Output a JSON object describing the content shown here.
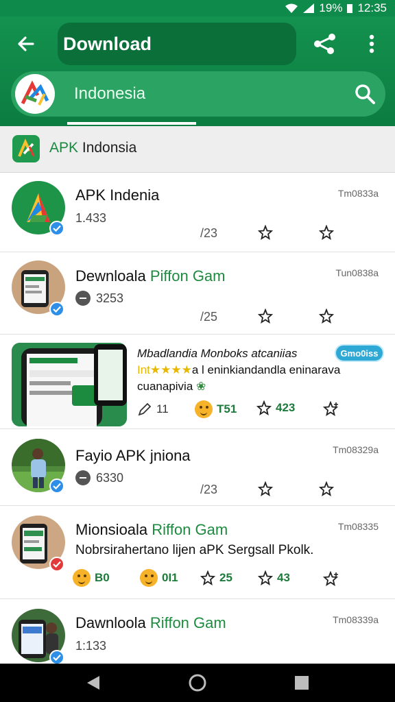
{
  "status": {
    "battery": "19%",
    "time": "12:35"
  },
  "header": {
    "title": "Download",
    "search_text": "Indonesia"
  },
  "section": {
    "title_green": "APK",
    "title_rest": " Indonsia"
  },
  "items": [
    {
      "name": "APK Indenia",
      "name_green": "",
      "meta": "1.433",
      "time": "Tm0833a",
      "count": "/23"
    },
    {
      "name": "Dewnloala ",
      "name_green": "Piffon Gam",
      "meta": "3253",
      "time": "Tun0838a",
      "count": "/25"
    },
    {
      "name": "Fayio APK jniona",
      "name_green": "",
      "meta": "6330",
      "time": "Tm08329a",
      "count": "/23"
    },
    {
      "name": "Mionsioala ",
      "name_green": "Riffon Gam",
      "desc": "Nobrsirahertano lijen aPK Sergsall Pkolk.",
      "time": "Tm08335",
      "reactions": [
        "B0",
        "0I1",
        "25",
        "43"
      ]
    },
    {
      "name": "Dawnloola ",
      "name_green": "Riffon Gam",
      "meta": "1:133",
      "time": "Tm08339a"
    }
  ],
  "promo": {
    "title": "Mbadlandia Monboks atcaniias",
    "stars": "Int★★★★",
    "line2_rest": "a l eninkiandandla eninarava",
    "line3": "cuanapivia",
    "pill": "Gmo0iss",
    "reactions": [
      "11",
      "T51",
      "423"
    ]
  },
  "colors": {
    "primary": "#0e8a4a",
    "accent_green": "#1c8b3f",
    "badge_blue": "#2e8fe8"
  }
}
